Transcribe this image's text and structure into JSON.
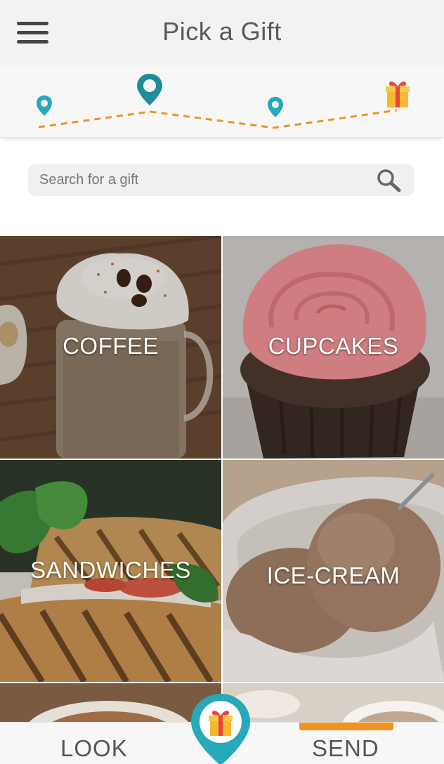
{
  "header": {
    "title": "Pick a Gift"
  },
  "search": {
    "placeholder": "Search for a gift"
  },
  "categories": [
    {
      "label": "COFFEE"
    },
    {
      "label": "CUPCAKES"
    },
    {
      "label": "SANDWICHES"
    },
    {
      "label": "ICE-CREAM"
    }
  ],
  "bottom_nav": {
    "look_label": "LOOK",
    "send_label": "SEND",
    "active_tab": "SEND"
  },
  "progress": {
    "steps": 4,
    "current_step": 2
  },
  "colors": {
    "accent_teal": "#26a9b8",
    "accent_orange": "#f29321",
    "gift_yellow": "#f5b82e",
    "gift_red": "#e8453c"
  },
  "icons": [
    "menu-icon",
    "location-pin-icon",
    "gift-icon",
    "search-icon"
  ]
}
